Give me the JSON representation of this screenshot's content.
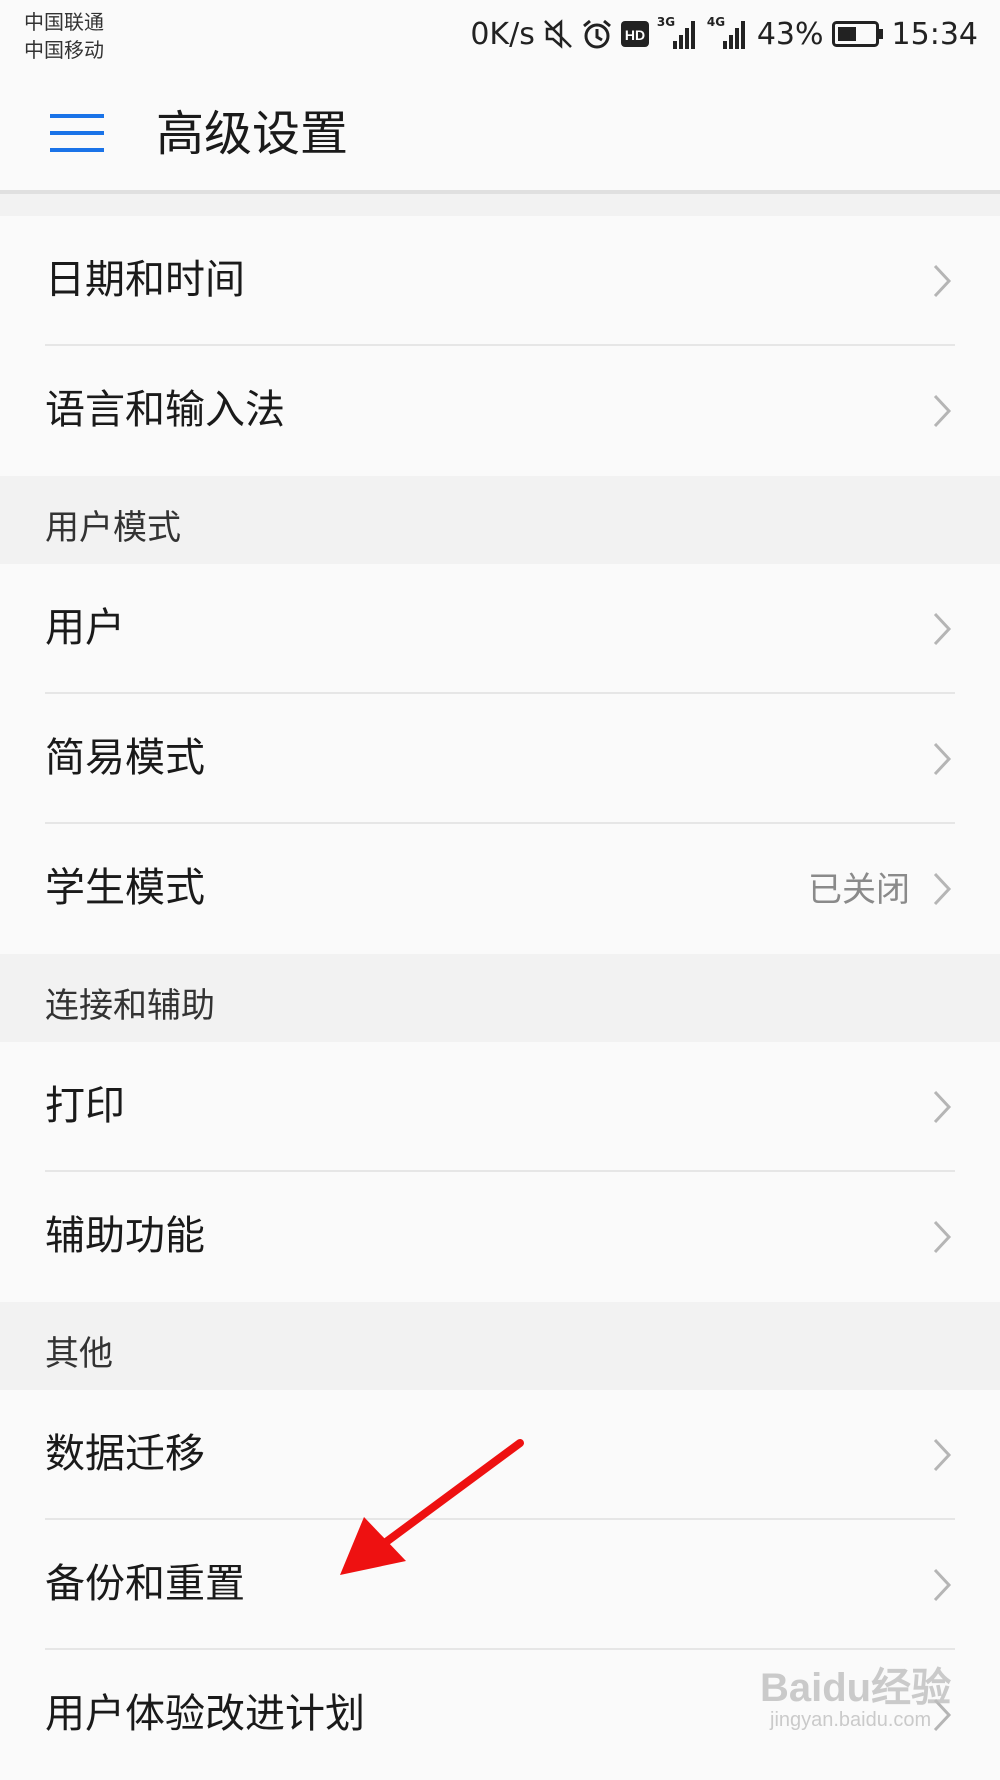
{
  "status_bar": {
    "carrier_1": "中国联通",
    "carrier_2": "中国移动",
    "net_speed": "0K/s",
    "network_1": "3G",
    "network_2": "4G",
    "battery": "43%",
    "time": "15:34",
    "icons": [
      "mute-icon",
      "alarm-icon",
      "hd-icon",
      "signal-icon",
      "battery-icon"
    ]
  },
  "header": {
    "title": "高级设置"
  },
  "groups": [
    {
      "header": "",
      "items": [
        {
          "label": "日期和时间",
          "value": ""
        },
        {
          "label": "语言和输入法",
          "value": ""
        }
      ]
    },
    {
      "header": "用户模式",
      "items": [
        {
          "label": "用户",
          "value": ""
        },
        {
          "label": "简易模式",
          "value": ""
        },
        {
          "label": "学生模式",
          "value": "已关闭"
        }
      ]
    },
    {
      "header": "连接和辅助",
      "items": [
        {
          "label": "打印",
          "value": ""
        },
        {
          "label": "辅助功能",
          "value": ""
        }
      ]
    },
    {
      "header": "其他",
      "items": [
        {
          "label": "数据迁移",
          "value": ""
        },
        {
          "label": "备份和重置",
          "value": ""
        },
        {
          "label": "用户体验改进计划",
          "value": ""
        }
      ]
    }
  ],
  "annotation": {
    "arrow_color": "#ee1111"
  },
  "watermark": {
    "logo": "Baidu经验",
    "url": "jingyan.baidu.com"
  },
  "colors": {
    "accent": "#1a73e8",
    "background": "#fafafa",
    "section_bg": "#f2f2f2"
  }
}
